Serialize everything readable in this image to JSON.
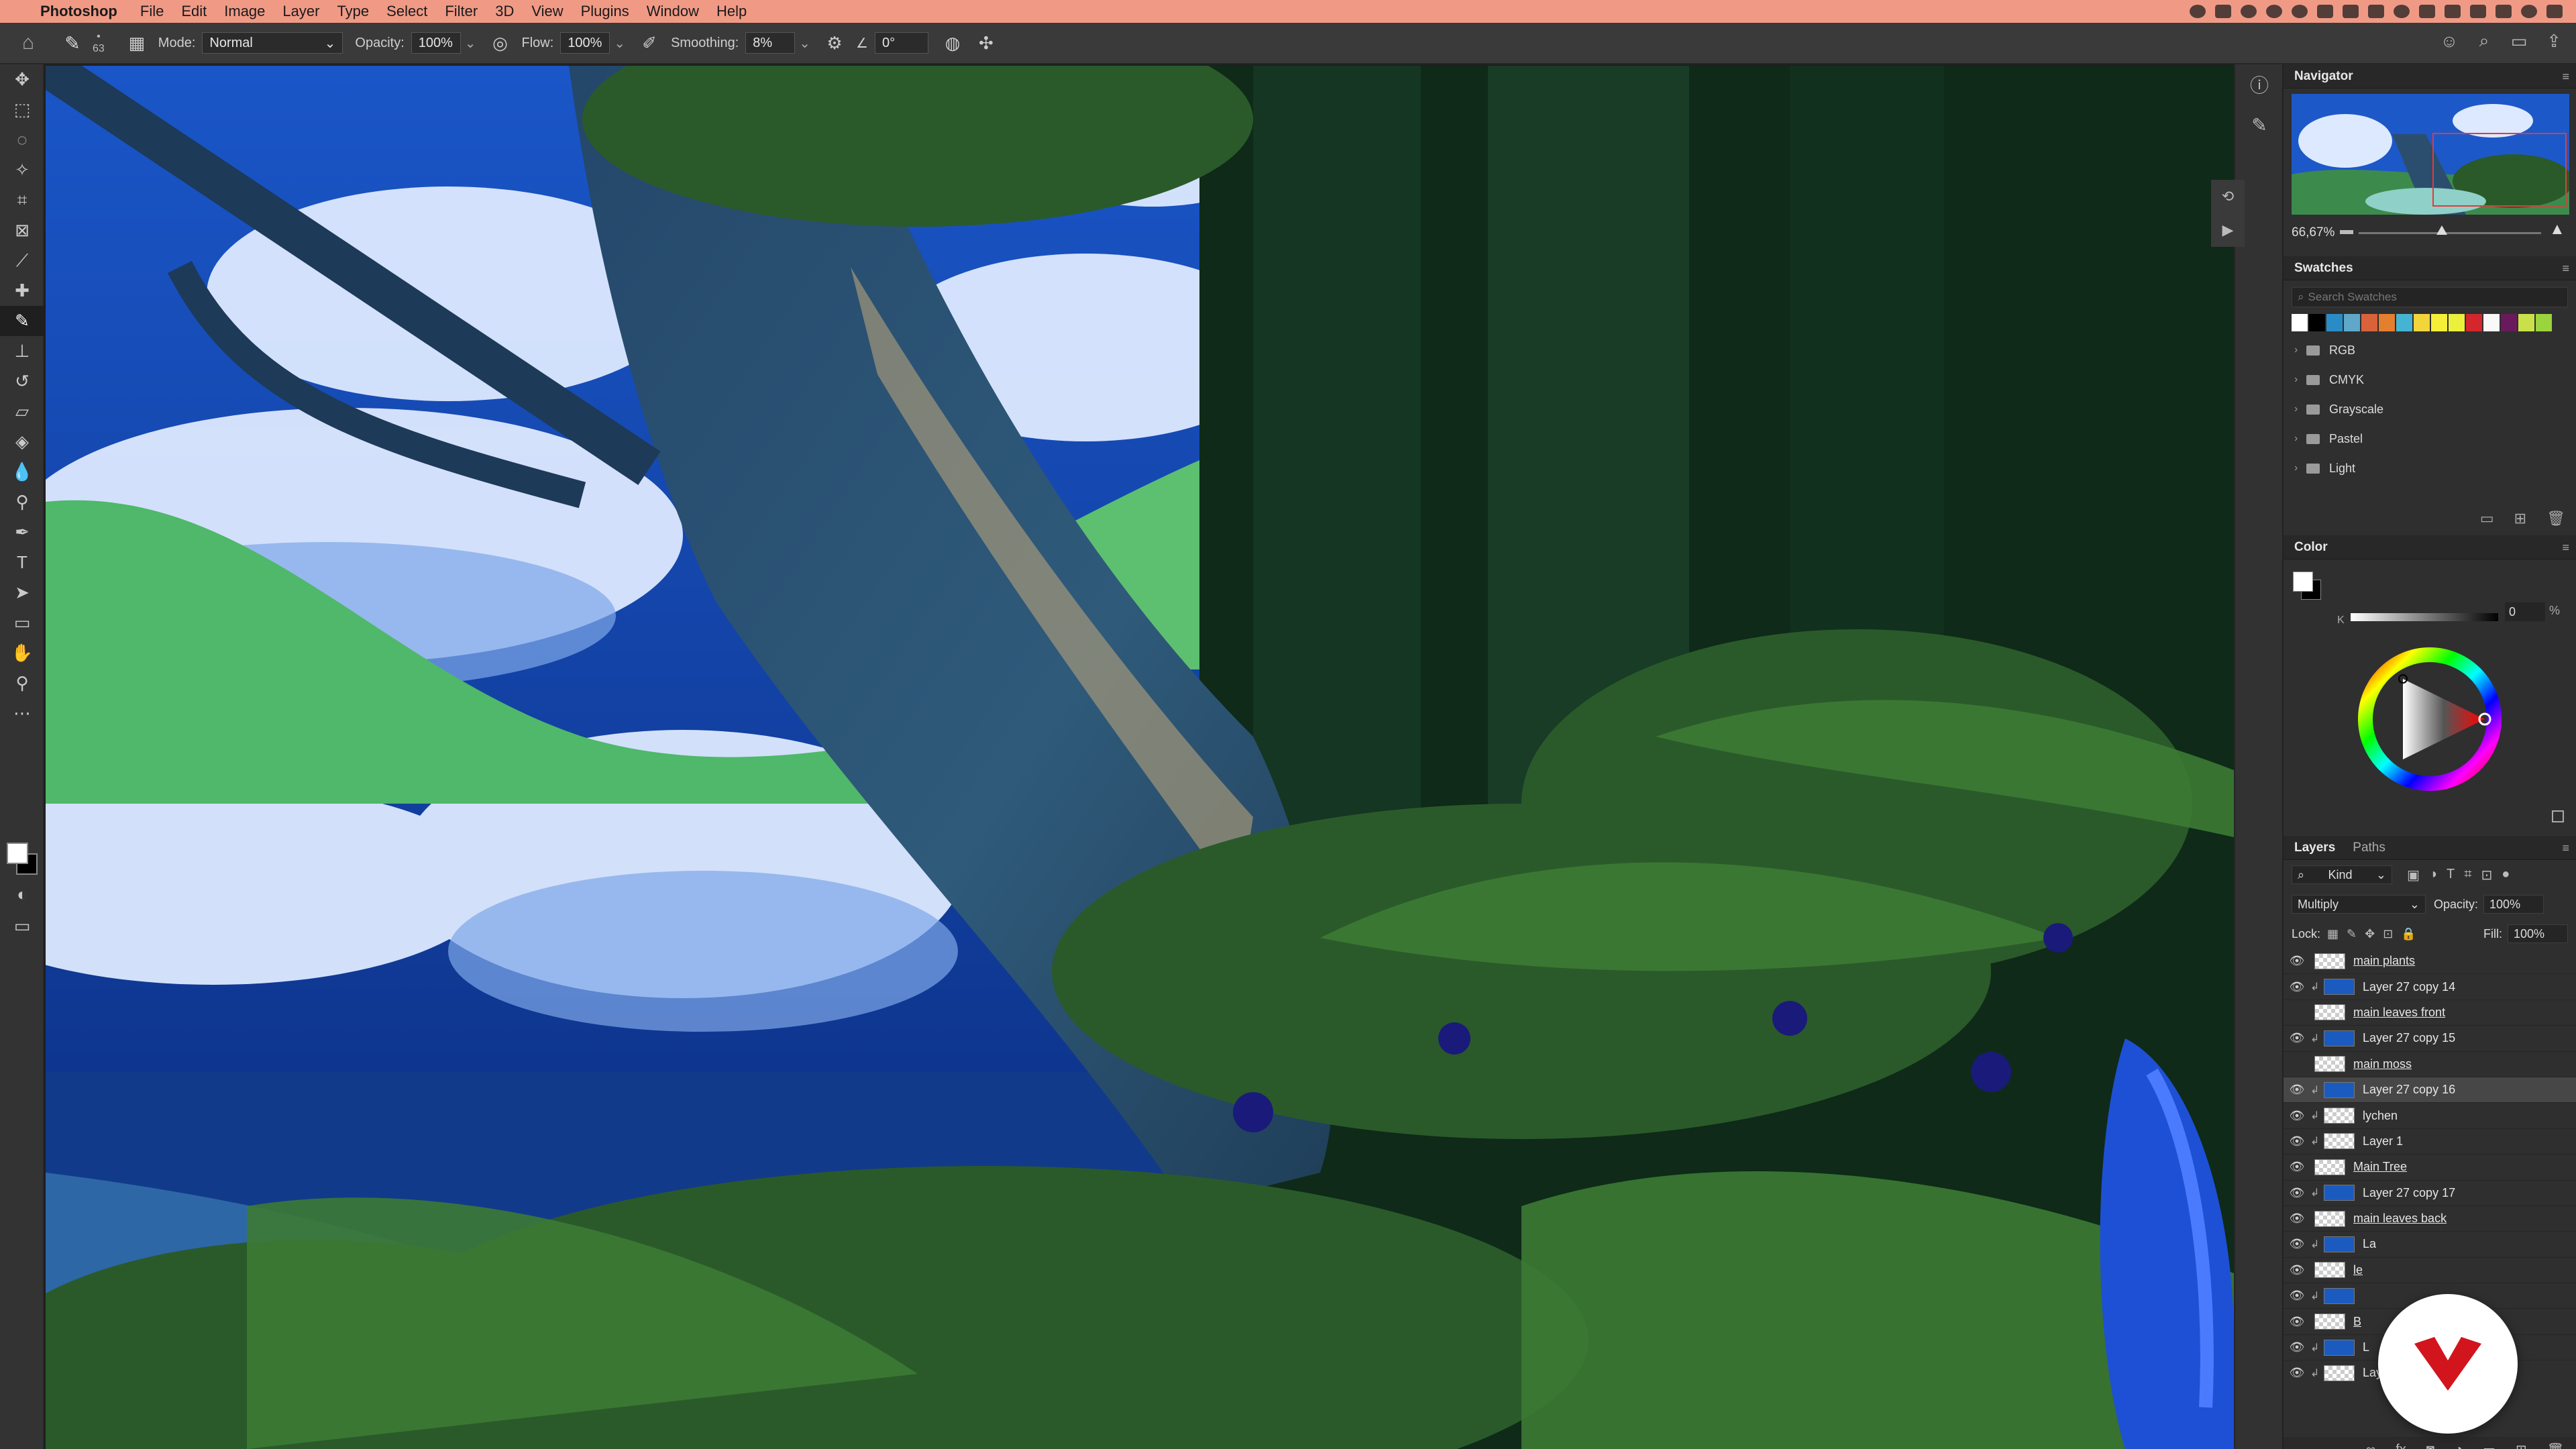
{
  "menubar": {
    "app_name": "Photoshop",
    "menus": [
      "File",
      "Edit",
      "Image",
      "Layer",
      "Type",
      "Select",
      "Filter",
      "3D",
      "View",
      "Plugins",
      "Window",
      "Help"
    ]
  },
  "options_bar": {
    "brush_size": "63",
    "mode_label": "Mode:",
    "mode_value": "Normal",
    "opacity_label": "Opacity:",
    "opacity_value": "100%",
    "flow_label": "Flow:",
    "flow_value": "100%",
    "smoothing_label": "Smoothing:",
    "smoothing_value": "8%",
    "angle_value": "0°"
  },
  "navigator": {
    "title": "Navigator",
    "zoom": "66,67%"
  },
  "swatches": {
    "title": "Swatches",
    "search_placeholder": "Search Swatches",
    "colors": [
      "#ffffff",
      "#000000",
      "#2a8cc7",
      "#5fa8c9",
      "#d9623b",
      "#e37f2e",
      "#45b4d3",
      "#f1d53a",
      "#f5ef3a",
      "#eaf03b",
      "#d3262d",
      "#f9f9f9",
      "#6a1a5c",
      "#c9e04a",
      "#9bd43c"
    ],
    "folders": [
      "RGB",
      "CMYK",
      "Grayscale",
      "Pastel",
      "Light"
    ]
  },
  "color": {
    "title": "Color",
    "channel_label": "K",
    "channel_value": "0",
    "channel_unit": "%"
  },
  "layers": {
    "tab_layers": "Layers",
    "tab_paths": "Paths",
    "filter_kind": "Kind",
    "blend_mode": "Multiply",
    "opacity_label": "Opacity:",
    "opacity_value": "100%",
    "lock_label": "Lock:",
    "fill_label": "Fill:",
    "fill_value": "100%",
    "items": [
      {
        "name": "main plants",
        "group": true,
        "clip": false,
        "thumb": "checker",
        "visible": true
      },
      {
        "name": "Layer 27 copy 14",
        "group": false,
        "clip": true,
        "thumb": "blue",
        "visible": true
      },
      {
        "name": "main leaves front",
        "group": true,
        "clip": false,
        "thumb": "checker",
        "visible": false
      },
      {
        "name": "Layer 27 copy 15",
        "group": false,
        "clip": true,
        "thumb": "blue",
        "visible": true
      },
      {
        "name": "main moss",
        "group": true,
        "clip": false,
        "thumb": "checker",
        "visible": false
      },
      {
        "name": "Layer 27 copy 16",
        "group": false,
        "clip": true,
        "thumb": "blue",
        "visible": true
      },
      {
        "name": "lychen",
        "group": false,
        "clip": true,
        "thumb": "checker",
        "visible": true
      },
      {
        "name": "Layer 1",
        "group": false,
        "clip": true,
        "thumb": "checker",
        "visible": true
      },
      {
        "name": "Main Tree",
        "group": true,
        "clip": false,
        "thumb": "checker",
        "visible": true
      },
      {
        "name": "Layer 27 copy 17",
        "group": false,
        "clip": true,
        "thumb": "blue",
        "visible": true
      },
      {
        "name": "main leaves back",
        "group": true,
        "clip": false,
        "thumb": "checker",
        "visible": true
      },
      {
        "name": "La",
        "group": false,
        "clip": true,
        "thumb": "blue",
        "visible": true
      },
      {
        "name": "le",
        "group": true,
        "clip": false,
        "thumb": "checker",
        "visible": true
      },
      {
        "name": "",
        "group": false,
        "clip": true,
        "thumb": "blue",
        "visible": true
      },
      {
        "name": "B",
        "group": true,
        "clip": false,
        "thumb": "checker",
        "visible": true
      },
      {
        "name": "L",
        "group": false,
        "clip": true,
        "thumb": "blue",
        "visible": true
      },
      {
        "name": "Layer 2",
        "group": false,
        "clip": true,
        "thumb": "checker",
        "visible": true
      }
    ]
  }
}
